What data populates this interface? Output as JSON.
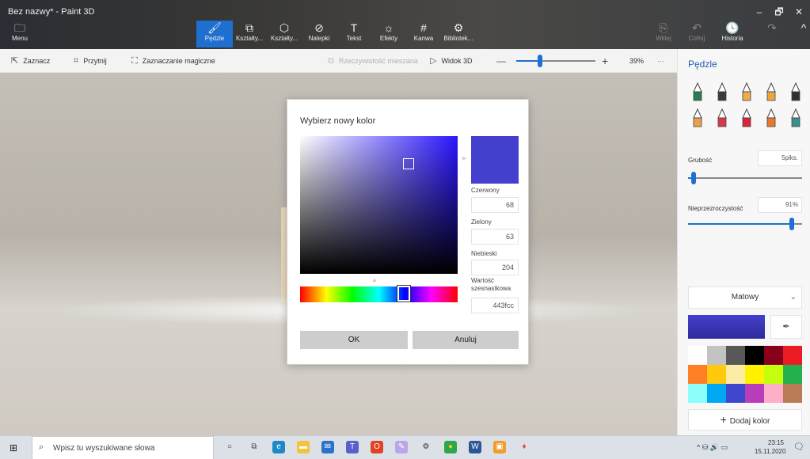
{
  "window": {
    "title": "Bez nazwy* - Paint 3D",
    "controls": {
      "minimize": "–",
      "maximize": "🗗",
      "close": "✕"
    }
  },
  "ribbon": {
    "menu": {
      "icon": "folder-icon",
      "glyph": "🗀",
      "label": "Menu"
    },
    "tools": [
      {
        "id": "brushes",
        "icon": "brush-icon",
        "glyph": "🖌",
        "label": "Pędzle",
        "active": true
      },
      {
        "id": "shapes2d",
        "icon": "shapes-2d-icon",
        "glyph": "⧉",
        "label": "Kształty...",
        "active": false
      },
      {
        "id": "shapes3d",
        "icon": "shapes-3d-icon",
        "glyph": "⬡",
        "label": "Kształty...",
        "active": false
      },
      {
        "id": "stickers",
        "icon": "sticker-icon",
        "glyph": "⊘",
        "label": "Nalepki",
        "active": false
      },
      {
        "id": "text",
        "icon": "text-icon",
        "glyph": "T",
        "label": "Tekst",
        "active": false
      },
      {
        "id": "effects",
        "icon": "effects-icon",
        "glyph": "☼",
        "label": "Efekty",
        "active": false
      },
      {
        "id": "canvas",
        "icon": "canvas-icon",
        "glyph": "#",
        "label": "Kanwa",
        "active": false
      },
      {
        "id": "library",
        "icon": "library-icon",
        "glyph": "⚙",
        "label": "Bibliotek...",
        "active": false
      }
    ],
    "right": [
      {
        "id": "paste",
        "icon": "paste-icon",
        "glyph": "⎘",
        "label": "Wklej",
        "enabled": false
      },
      {
        "id": "undo",
        "icon": "undo-icon",
        "glyph": "↶",
        "label": "Cofnij",
        "enabled": false
      },
      {
        "id": "history",
        "icon": "history-icon",
        "glyph": "🕓",
        "label": "Historia",
        "enabled": true
      },
      {
        "id": "redo",
        "icon": "redo-icon",
        "glyph": "↷",
        "label": "",
        "enabled": false
      },
      {
        "id": "collapse",
        "icon": "chevron-up-icon",
        "glyph": "^",
        "label": "",
        "enabled": true
      }
    ]
  },
  "toolbar": {
    "select": {
      "label": "Zaznacz",
      "glyph": "⇱"
    },
    "crop": {
      "label": "Przytnij",
      "glyph": "⌗"
    },
    "magic_select": {
      "label": "Zaznaczanie magiczne",
      "glyph": "⛶"
    },
    "mixed_reality": {
      "label": "Rzeczywistość mieszana",
      "glyph": "⧉"
    },
    "view3d": {
      "label": "Widok 3D",
      "glyph": "▷"
    },
    "zoom_out": "—",
    "zoom_in": "+",
    "zoom_level": "39%",
    "zoom_fraction": 0.3,
    "more": "···"
  },
  "dialog": {
    "title": "Wybierz nowy kolor",
    "selected_color": "#443fcc",
    "sv_position": {
      "saturation": 0.69,
      "value": 0.8
    },
    "hue_fraction": 0.66,
    "fields": {
      "red_label": "Czerwony",
      "red_value": "68",
      "green_label": "Zielony",
      "green_value": "63",
      "blue_label": "Niebieski",
      "blue_value": "204",
      "hex_label": "Wartość szesnastkowa",
      "hex_value": "443fcc"
    },
    "ok_label": "OK",
    "cancel_label": "Anuluj"
  },
  "panel": {
    "title": "Pędzle",
    "brushes": [
      {
        "name": "marker",
        "color": "#2a7d4f"
      },
      {
        "name": "calligraphy-pen",
        "color": "#3a3a3a"
      },
      {
        "name": "oil-brush",
        "color": "#f2a94e"
      },
      {
        "name": "watercolor",
        "color": "#f0a43c"
      },
      {
        "name": "pixel-pen",
        "color": "#303030"
      },
      {
        "name": "pencil",
        "color": "#e8a24a"
      },
      {
        "name": "eraser",
        "color": "#d93a4a"
      },
      {
        "name": "crayon",
        "color": "#d9243a"
      },
      {
        "name": "spray-can",
        "color": "#e8782a"
      },
      {
        "name": "fill",
        "color": "#3a8f8a"
      }
    ],
    "thickness_label": "Grubość",
    "thickness_value": "5piks.",
    "thickness_fraction": 0.05,
    "opacity_label": "Nieprzezroczystość",
    "opacity_value": "91%",
    "opacity_fraction": 0.91,
    "finish_label": "Matowy",
    "current_color": "#443fcc",
    "palette": [
      "#ffffff",
      "#c3c3c3",
      "#585858",
      "#000000",
      "#88001b",
      "#ec1c24",
      "#ff7f27",
      "#ffc90e",
      "#fdeca6",
      "#fff200",
      "#c4ff0e",
      "#22b14c",
      "#8cfffb",
      "#00a8f3",
      "#3f48cc",
      "#b83dba",
      "#ffaec8",
      "#b97a56"
    ],
    "add_color_label": "Dodaj kolor"
  },
  "taskbar": {
    "search_placeholder": "Wpisz tu wyszukiwane słowa",
    "apps": [
      {
        "name": "cortana-icon",
        "glyph": "○",
        "bg": "transparent",
        "fg": "#222"
      },
      {
        "name": "task-view-icon",
        "glyph": "⧉",
        "bg": "transparent",
        "fg": "#444"
      },
      {
        "name": "edge-icon",
        "glyph": "e",
        "bg": "#1e88c7",
        "fg": "#fff"
      },
      {
        "name": "file-explorer-icon",
        "glyph": "▬",
        "bg": "#f3c33a",
        "fg": "#fff"
      },
      {
        "name": "mail-icon",
        "glyph": "✉",
        "bg": "#2b73c9",
        "fg": "#fff"
      },
      {
        "name": "teams-icon",
        "glyph": "T",
        "bg": "#5b5fc7",
        "fg": "#fff"
      },
      {
        "name": "office-icon",
        "glyph": "O",
        "bg": "#e2431f",
        "fg": "#fff"
      },
      {
        "name": "paint-icon",
        "glyph": "✎",
        "bg": "#b9a8e8",
        "fg": "#fff"
      },
      {
        "name": "settings-icon",
        "glyph": "⚙",
        "bg": "transparent",
        "fg": "#333"
      },
      {
        "name": "chrome-icon",
        "glyph": "●",
        "bg": "#2aa84a",
        "fg": "#fbc02d"
      },
      {
        "name": "word-icon",
        "glyph": "W",
        "bg": "#2b5797",
        "fg": "#fff"
      },
      {
        "name": "photos-icon",
        "glyph": "▣",
        "bg": "#f39c2a",
        "fg": "#fff"
      },
      {
        "name": "paint3d-icon",
        "glyph": "♦",
        "bg": "transparent",
        "fg": "#e0473a"
      }
    ],
    "time": "23:15",
    "date": "15.11.2020",
    "tray": "^ ⛁ 🔊 ▭"
  }
}
